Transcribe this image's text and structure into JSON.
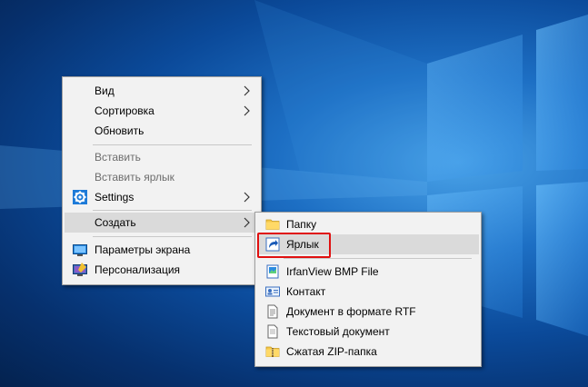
{
  "desktop": {
    "background_color": "#0b4a9a"
  },
  "context_menu": {
    "items": [
      {
        "label": "Вид",
        "has_submenu": true
      },
      {
        "label": "Сортировка",
        "has_submenu": true
      },
      {
        "label": "Обновить"
      },
      {
        "label": "Вставить",
        "disabled": true
      },
      {
        "label": "Вставить ярлык",
        "disabled": true
      },
      {
        "label": "Settings",
        "icon": "gear-icon",
        "has_submenu": true
      },
      {
        "label": "Создать",
        "has_submenu": true,
        "highlighted": true
      },
      {
        "label": "Параметры экрана",
        "icon": "display-icon"
      },
      {
        "label": "Персонализация",
        "icon": "personalization-icon"
      }
    ]
  },
  "submenu_create": {
    "items": [
      {
        "label": "Папку",
        "icon": "folder-icon"
      },
      {
        "label": "Ярлык",
        "icon": "shortcut-icon",
        "highlighted": true
      },
      {
        "label": "IrfanView BMP File",
        "icon": "bmp-file-icon"
      },
      {
        "label": "Контакт",
        "icon": "contact-icon"
      },
      {
        "label": "Документ в формате RTF",
        "icon": "rtf-document-icon"
      },
      {
        "label": "Текстовый документ",
        "icon": "text-document-icon"
      },
      {
        "label": "Сжатая ZIP-папка",
        "icon": "zip-folder-icon"
      }
    ]
  },
  "annotation": {
    "highlight_color": "#e01010"
  }
}
